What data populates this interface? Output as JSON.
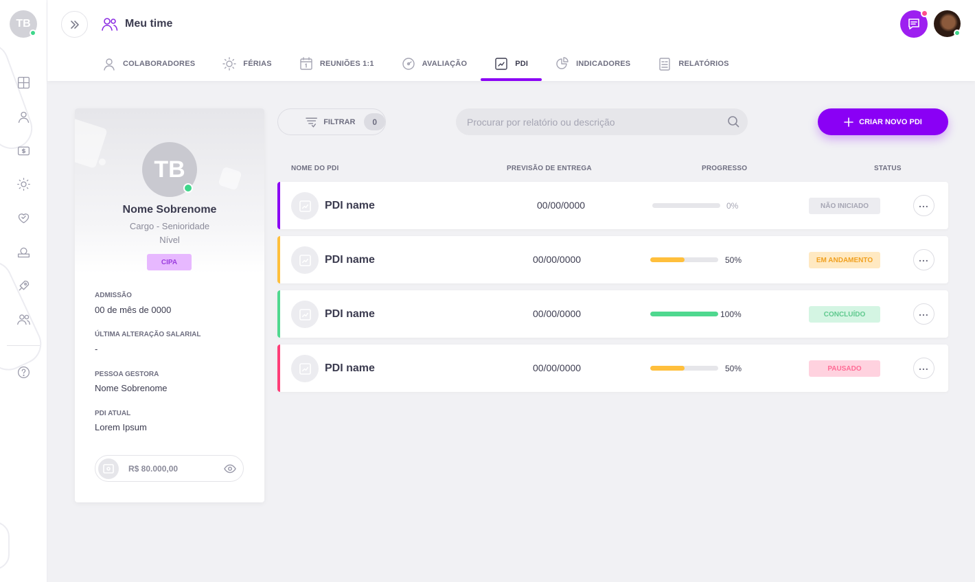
{
  "rail": {
    "avatar_initials": "TB",
    "icons": [
      "dashboard-icon",
      "user-icon",
      "money-icon",
      "sun-icon",
      "heart-icon",
      "wallet-icon",
      "rocket-icon",
      "team-icon",
      "help-icon"
    ]
  },
  "header": {
    "title": "Meu time",
    "tabs": [
      {
        "label": "COLABORADORES",
        "icon": "user-icon"
      },
      {
        "label": "FÉRIAS",
        "icon": "sun-icon"
      },
      {
        "label": "REUNIÕES 1:1",
        "icon": "calendar-icon"
      },
      {
        "label": "AVALIAÇÃO",
        "icon": "gauge-icon"
      },
      {
        "label": "PDI",
        "icon": "chart-icon",
        "active": true
      },
      {
        "label": "INDICADORES",
        "icon": "pie-icon"
      },
      {
        "label": "RELATÓRIOS",
        "icon": "report-icon"
      }
    ]
  },
  "profile": {
    "initials": "TB",
    "name": "Nome Sobrenome",
    "role": "Cargo - Senioridade",
    "level": "Nível",
    "badge": "CIPA",
    "fields": [
      {
        "label": "ADMISSÃO",
        "value": "00 de mês de 0000"
      },
      {
        "label": "ÚLTIMA ALTERAÇÃO SALARIAL",
        "value": "-"
      },
      {
        "label": "PESSOA GESTORA",
        "value": "Nome Sobrenome"
      },
      {
        "label": "PDI ATUAL",
        "value": "Lorem Ipsum"
      }
    ],
    "salary": "R$ 80.000,00"
  },
  "toolbar": {
    "filter_label": "FILTRAR",
    "filter_count": "0",
    "search_placeholder": "Procurar por relatório ou descrição",
    "create_label": "CRIAR NOVO PDI"
  },
  "table": {
    "headers": {
      "name": "NOME DO PDI",
      "date": "PREVISÃO DE ENTREGA",
      "progress": "PROGRESSO",
      "status": "STATUS"
    },
    "rows": [
      {
        "name": "PDI name",
        "date": "00/00/0000",
        "progress": 0,
        "progress_label": "0%",
        "status": "NÃO INICIADO",
        "accent": "#8a00f5",
        "bar_color": "#e6e6ea",
        "status_bg": "#ececf0",
        "status_color": "#a5a5b3"
      },
      {
        "name": "PDI name",
        "date": "00/00/0000",
        "progress": 50,
        "progress_label": "50%",
        "status": "EM ANDAMENTO",
        "accent": "#ffbf3c",
        "bar_color": "#ffbf3c",
        "status_bg": "#ffe9c2",
        "status_color": "#f0a020"
      },
      {
        "name": "PDI name",
        "date": "00/00/0000",
        "progress": 100,
        "progress_label": "100%",
        "status": "CONCLUÍDO",
        "accent": "#4fd88f",
        "bar_color": "#4fd88f",
        "status_bg": "#d4f5e3",
        "status_color": "#5fc98e"
      },
      {
        "name": "PDI name",
        "date": "00/00/0000",
        "progress": 50,
        "progress_label": "50%",
        "status": "PAUSADO",
        "accent": "#ff3d78",
        "bar_color": "#ffbf3c",
        "status_bg": "#ffd2df",
        "status_color": "#ff6b95"
      }
    ]
  }
}
